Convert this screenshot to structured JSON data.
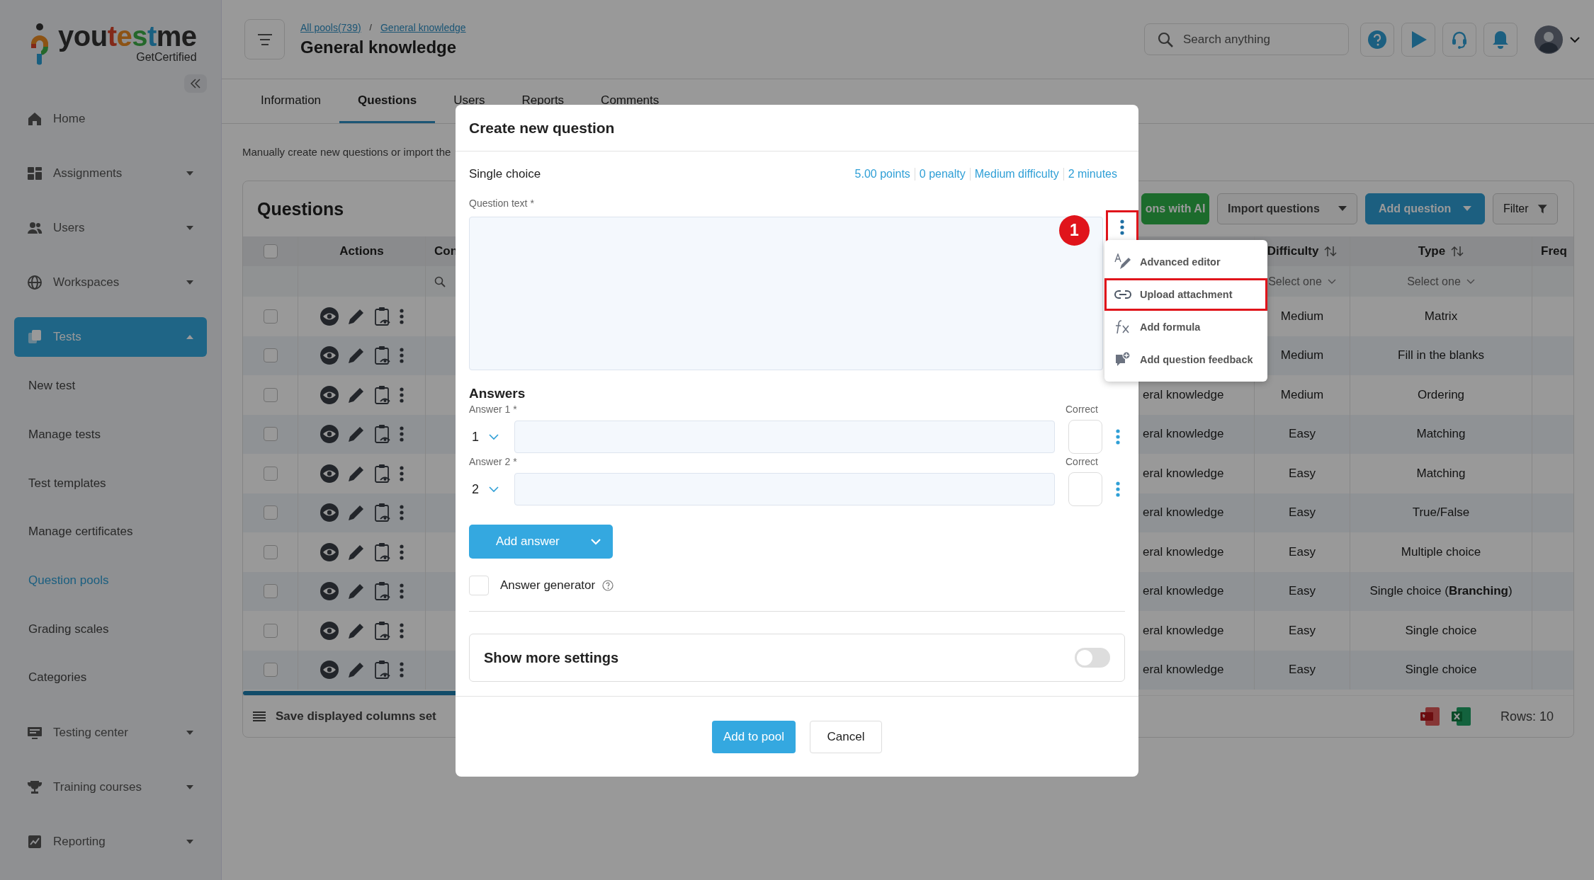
{
  "sidebar": {
    "logo": {
      "name": "youtestme",
      "tagline": "GetCertified"
    },
    "items": [
      {
        "label": "Home",
        "selected": false
      },
      {
        "label": "Assignments",
        "selected": false,
        "expanded": false
      },
      {
        "label": "Users",
        "selected": false,
        "expanded": false
      },
      {
        "label": "Workspaces",
        "selected": false,
        "expanded": false
      },
      {
        "label": "Tests",
        "selected": true,
        "expanded": true,
        "children": [
          {
            "label": "New test",
            "selected": false
          },
          {
            "label": "Manage tests",
            "selected": false
          },
          {
            "label": "Test templates",
            "selected": false
          },
          {
            "label": "Manage certificates",
            "selected": false
          },
          {
            "label": "Question pools",
            "selected": true
          },
          {
            "label": "Grading scales",
            "selected": false
          },
          {
            "label": "Categories",
            "selected": false
          }
        ]
      },
      {
        "label": "Testing center",
        "selected": false,
        "expanded": false
      },
      {
        "label": "Training courses",
        "selected": false,
        "expanded": false
      },
      {
        "label": "Reporting",
        "selected": false,
        "expanded": false
      }
    ]
  },
  "header": {
    "breadcrumb": [
      "All pools(739)",
      "General knowledge"
    ],
    "breadcrumb_separator": "/",
    "title": "General knowledge",
    "search": {
      "placeholder": "Search anything"
    }
  },
  "tabs": [
    {
      "label": "Information",
      "selected": false
    },
    {
      "label": "Questions",
      "selected": true
    },
    {
      "label": "Users",
      "selected": false
    },
    {
      "label": "Reports",
      "selected": false
    },
    {
      "label": "Comments",
      "selected": false
    }
  ],
  "description": "Manually create new questions or import the",
  "questions": {
    "title": "Questions",
    "toolbar": [
      {
        "label": "ons with AI",
        "kind": "ai"
      },
      {
        "label": "Import questions",
        "kind": "split"
      },
      {
        "label": "Add question",
        "kind": "primary"
      },
      {
        "label": "Filter",
        "kind": "filter"
      }
    ],
    "select_all_checked": false,
    "columns": [
      {
        "label": "Actions"
      },
      {
        "label": "Con",
        "search_filter": true
      },
      {
        "label": "Difficulty",
        "sortable": true,
        "filter_placeholder": "Select one"
      },
      {
        "label": "Type",
        "sortable": true,
        "filter_placeholder": "Select one"
      },
      {
        "label": "Freq"
      }
    ],
    "rows": [
      {
        "checked": false,
        "difficulty": "Medium",
        "type": "Matrix"
      },
      {
        "checked": false,
        "difficulty": "Medium",
        "type": "Fill in the blanks"
      },
      {
        "checked": false,
        "pool": "eral knowledge",
        "difficulty": "Medium",
        "type": "Ordering"
      },
      {
        "checked": false,
        "pool": "eral knowledge",
        "difficulty": "Easy",
        "type": "Matching"
      },
      {
        "checked": false,
        "pool": "eral knowledge",
        "difficulty": "Easy",
        "type": "Matching"
      },
      {
        "checked": false,
        "pool": "eral knowledge",
        "difficulty": "Easy",
        "type": "True/False"
      },
      {
        "checked": false,
        "pool": "eral knowledge",
        "difficulty": "Easy",
        "type": "Multiple choice"
      },
      {
        "checked": false,
        "pool": "eral knowledge",
        "difficulty": "Easy",
        "type": "Single choice (**Branching**)"
      },
      {
        "checked": false,
        "pool": "eral knowledge",
        "difficulty": "Easy",
        "type": "Single choice"
      },
      {
        "checked": false,
        "pool": "eral knowledge",
        "difficulty": "Easy",
        "type": "Single choice"
      }
    ],
    "footer": {
      "save_label": "Save displayed columns set",
      "rows_count": "Rows: 10"
    }
  },
  "modal": {
    "title": "Create new question",
    "question_type": "Single choice",
    "meta": [
      "5.00 points",
      "0 penalty",
      "Medium difficulty",
      "2 minutes"
    ],
    "question_text_label": "Question text *",
    "callout": "1",
    "more_highlighted": true,
    "menu": [
      {
        "label": "Advanced editor",
        "selected": false
      },
      {
        "label": "Upload attachment",
        "selected": true
      },
      {
        "label": "Add formula",
        "selected": false
      },
      {
        "label": "Add question feedback",
        "selected": false
      }
    ],
    "answers_title": "Answers",
    "answers": [
      {
        "label": "Answer 1 *",
        "number": "1",
        "correct_label": "Correct",
        "correct": false
      },
      {
        "label": "Answer 2 *",
        "number": "2",
        "correct_label": "Correct",
        "correct": false
      }
    ],
    "add_answer": "Add answer",
    "answer_generator": {
      "label": "Answer generator",
      "checked": false
    },
    "more_settings": {
      "label": "Show more settings",
      "on": false
    },
    "buttons": [
      {
        "label": "Add to pool",
        "kind": "primary"
      },
      {
        "label": "Cancel",
        "kind": "secondary"
      }
    ]
  }
}
